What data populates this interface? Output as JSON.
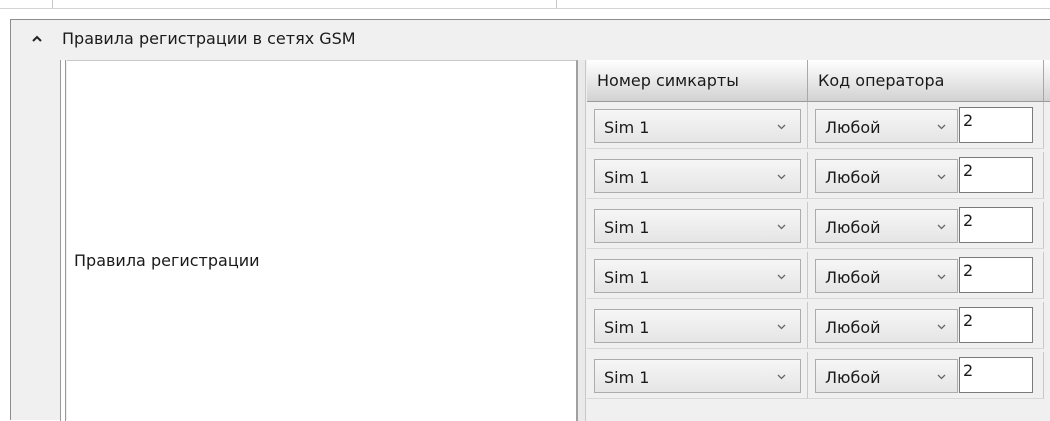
{
  "group": {
    "title": "Правила регистрации в сетях GSM",
    "expanded": true
  },
  "label": "Правила регистрации",
  "table": {
    "columns": [
      "Номер симкарты",
      "Код оператора"
    ],
    "rows": [
      {
        "sim": "Sim 1",
        "operator": "Любой",
        "code": "2"
      },
      {
        "sim": "Sim 1",
        "operator": "Любой",
        "code": "2"
      },
      {
        "sim": "Sim 1",
        "operator": "Любой",
        "code": "2"
      },
      {
        "sim": "Sim 1",
        "operator": "Любой",
        "code": "2"
      },
      {
        "sim": "Sim 1",
        "operator": "Любой",
        "code": "2"
      },
      {
        "sim": "Sim 1",
        "operator": "Любой",
        "code": "2"
      }
    ]
  },
  "icons": {
    "collapse": "chevron-up-icon",
    "dropdown": "chevron-down-icon"
  },
  "colors": {
    "panel": "#f0f0f0",
    "header_text": "#1a1a1a",
    "input_border": "#7a7a7a"
  }
}
